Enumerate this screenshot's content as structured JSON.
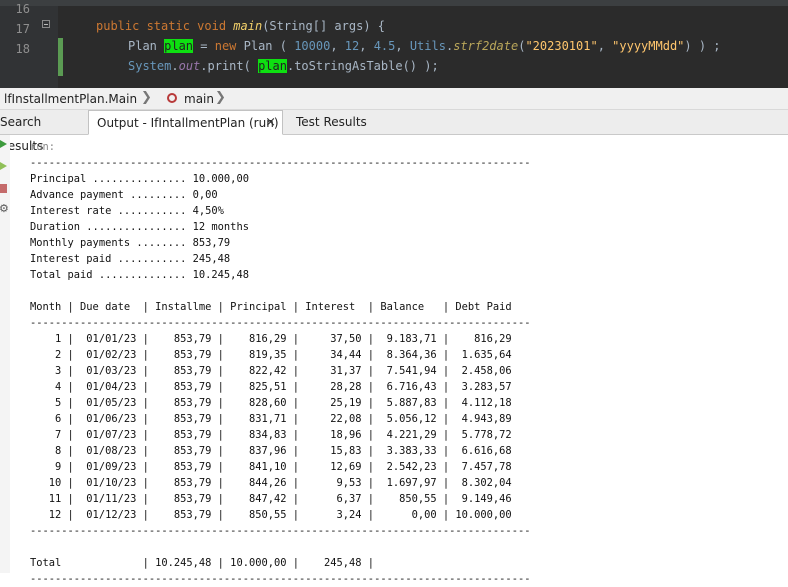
{
  "editor": {
    "line_numbers": [
      "16",
      "17",
      "18"
    ],
    "line16": {
      "kw1": "public static void ",
      "method": "main",
      "rest": "(String[] args) {"
    },
    "line17": {
      "type": "Plan ",
      "var": "plan",
      "eq": " = ",
      "kw_new": "new",
      "ctor": " Plan ( ",
      "n1": "10000",
      "c1": ", ",
      "n2": "12",
      "c2": ", ",
      "n3": "4.5",
      "c3": ", ",
      "cls": "Utils",
      "dot": ".",
      "smethod": "strf2date",
      "open": "(",
      "s1": "\"20230101\"",
      "c4": ", ",
      "s2": "\"yyyyMMdd\"",
      "close": ") ) ;"
    },
    "line18": {
      "sys": "System",
      "dot1": ".",
      "out": "out",
      "print": ".print( ",
      "var": "plan",
      "rest": ".toStringAsTable() );"
    }
  },
  "breadcrumb": {
    "class_label": "lfInstallmentPlan.Main",
    "method_label": "main",
    "sep": "❯"
  },
  "tabs": [
    {
      "label": "Search Results"
    },
    {
      "label": "Output - IfIntallmentPlan (run)",
      "close": "×"
    },
    {
      "label": "Test Results"
    }
  ],
  "output": {
    "run_label": "run:",
    "text": "--------------------------------------------------------------------------------\nPrincipal ............... 10.000,00\nAdvance payment ......... 0,00\nInterest rate ........... 4,50%\nDuration ................ 12 months\nMonthly payments ........ 853,79\nInterest paid ........... 245,48\nTotal paid .............. 10.245,48\n\nMonth | Due date  | Installme | Principal | Interest  | Balance   | Debt Paid\n--------------------------------------------------------------------------------\n    1 |  01/01/23 |    853,79 |    816,29 |     37,50 |  9.183,71 |    816,29\n    2 |  01/02/23 |    853,79 |    819,35 |     34,44 |  8.364,36 |  1.635,64\n    3 |  01/03/23 |    853,79 |    822,42 |     31,37 |  7.541,94 |  2.458,06\n    4 |  01/04/23 |    853,79 |    825,51 |     28,28 |  6.716,43 |  3.283,57\n    5 |  01/05/23 |    853,79 |    828,60 |     25,19 |  5.887,83 |  4.112,18\n    6 |  01/06/23 |    853,79 |    831,71 |     22,08 |  5.056,12 |  4.943,89\n    7 |  01/07/23 |    853,79 |    834,83 |     18,96 |  4.221,29 |  5.778,72\n    8 |  01/08/23 |    853,79 |    837,96 |     15,83 |  3.383,33 |  6.616,68\n    9 |  01/09/23 |    853,79 |    841,10 |     12,69 |  2.542,23 |  7.457,78\n   10 |  01/10/23 |    853,79 |    844,26 |      9,53 |  1.697,97 |  8.302,04\n   11 |  01/11/23 |    853,79 |    847,42 |      6,37 |    850,55 |  9.149,46\n   12 |  01/12/23 |    853,79 |    850,55 |      3,24 |      0,00 | 10.000,00\n--------------------------------------------------------------------------------\n\nTotal             | 10.245,48 | 10.000,00 |    245,48 |\n--------------------------------------------------------------------------------"
  },
  "colors": {
    "editor_bg": "#2b2b2b",
    "highlight": "#0ee011",
    "keyword": "#cc7832"
  }
}
